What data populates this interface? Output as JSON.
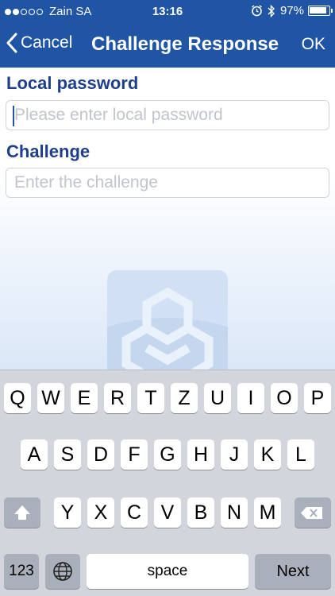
{
  "status_bar": {
    "carrier": "Zain SA",
    "time": "13:16",
    "battery": "97%",
    "battery_level": 0.97,
    "signal_bars": 2,
    "icons": [
      "alarm-icon",
      "bluetooth-icon"
    ]
  },
  "nav_bar": {
    "back_label": "Cancel",
    "title": "Challenge Response",
    "action_label": "OK"
  },
  "form": {
    "password_label": "Local password",
    "password_placeholder": "Please enter local password",
    "challenge_label": "Challenge",
    "challenge_placeholder": "Enter the challenge"
  },
  "keyboard": {
    "row1": [
      "Q",
      "W",
      "E",
      "R",
      "T",
      "Z",
      "U",
      "I",
      "O",
      "P"
    ],
    "row2": [
      "A",
      "S",
      "D",
      "F",
      "G",
      "H",
      "J",
      "K",
      "L"
    ],
    "row3": [
      "Y",
      "X",
      "C",
      "V",
      "B",
      "N",
      "M"
    ],
    "numbers_label": "123",
    "space_label": "space",
    "return_label": "Next"
  },
  "colors": {
    "nav_background": "#1f55a4",
    "label_text": "#1f3f8a",
    "keyboard_background": "#d2d5db"
  }
}
